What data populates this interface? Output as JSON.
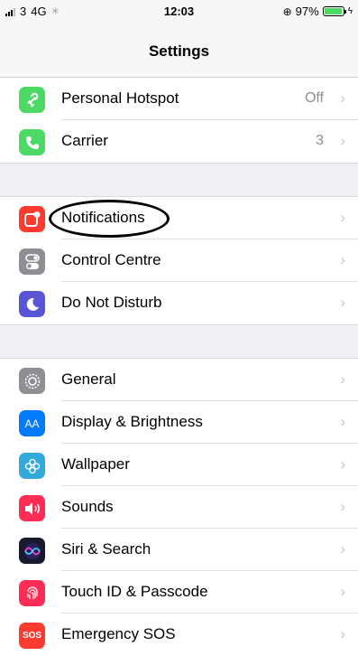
{
  "status_bar": {
    "carrier": "3",
    "network": "4G",
    "time": "12:03",
    "battery_percent": "97%",
    "battery_level": 0.97
  },
  "nav": {
    "title": "Settings"
  },
  "groups": [
    {
      "items": [
        {
          "id": "personal-hotspot",
          "label": "Personal Hotspot",
          "value": "Off",
          "icon": "hotspot-icon"
        },
        {
          "id": "carrier",
          "label": "Carrier",
          "value": "3",
          "icon": "phone-icon"
        }
      ]
    },
    {
      "items": [
        {
          "id": "notifications",
          "label": "Notifications",
          "value": "",
          "icon": "notifications-icon"
        },
        {
          "id": "control-centre",
          "label": "Control Centre",
          "value": "",
          "icon": "toggles-icon"
        },
        {
          "id": "do-not-disturb",
          "label": "Do Not Disturb",
          "value": "",
          "icon": "moon-icon"
        }
      ]
    },
    {
      "items": [
        {
          "id": "general",
          "label": "General",
          "value": "",
          "icon": "gear-icon"
        },
        {
          "id": "display-brightness",
          "label": "Display & Brightness",
          "value": "",
          "icon": "text-size-icon",
          "icon_text": "AA"
        },
        {
          "id": "wallpaper",
          "label": "Wallpaper",
          "value": "",
          "icon": "flower-icon"
        },
        {
          "id": "sounds",
          "label": "Sounds",
          "value": "",
          "icon": "speaker-icon"
        },
        {
          "id": "siri-search",
          "label": "Siri & Search",
          "value": "",
          "icon": "siri-icon"
        },
        {
          "id": "touch-id-passcode",
          "label": "Touch ID & Passcode",
          "value": "",
          "icon": "fingerprint-icon"
        },
        {
          "id": "emergency-sos",
          "label": "Emergency SOS",
          "value": "",
          "icon": "sos-icon",
          "icon_text": "SOS"
        }
      ]
    }
  ],
  "chevron": "›",
  "colors": {
    "green": "#4cd964",
    "red": "#ff3b30",
    "purple": "#5856d6",
    "gray": "#8e8e93",
    "blue": "#007aff",
    "pink": "#ff2d55"
  }
}
